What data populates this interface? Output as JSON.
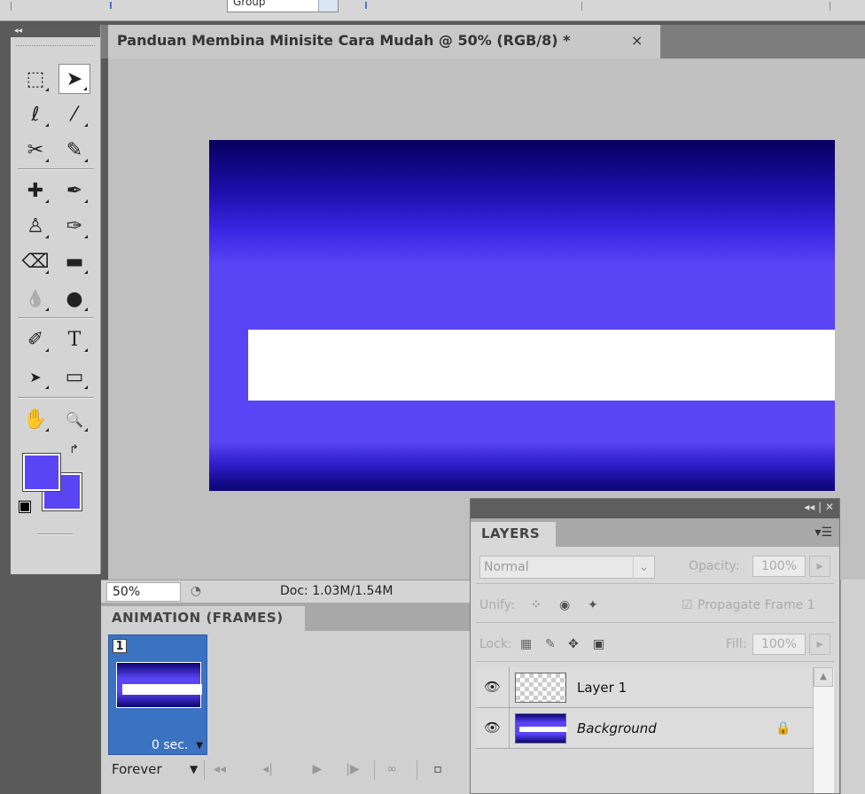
{
  "options_bar": {
    "group_field": "Group"
  },
  "document": {
    "tab_title": "Panduan Membina Minisite Cara Mudah @ 50% (RGB/8) *",
    "close_glyph": "×",
    "zoom": "50%",
    "doc_info": "Doc: 1.03M/1.54M",
    "colors": {
      "blue": "#5a45f6",
      "dark_blue": "#08005e",
      "white": "#ffffff"
    }
  },
  "toolbox": {
    "collapse": "◂◂",
    "tools": [
      {
        "name": "marquee-icon",
        "glyph": "⬚"
      },
      {
        "name": "move-icon",
        "glyph": "➤"
      },
      {
        "name": "lasso-icon",
        "glyph": "ℓ"
      },
      {
        "name": "magic-wand-icon",
        "glyph": "⁄"
      },
      {
        "name": "crop-icon",
        "glyph": "✂"
      },
      {
        "name": "eyedropper-icon",
        "glyph": "✎"
      },
      {
        "name": "healing-brush-icon",
        "glyph": "✚"
      },
      {
        "name": "brush-icon",
        "glyph": "✒"
      },
      {
        "name": "stamp-icon",
        "glyph": "♙"
      },
      {
        "name": "history-brush-icon",
        "glyph": "✑"
      },
      {
        "name": "eraser-icon",
        "glyph": "⌫"
      },
      {
        "name": "gradient-icon",
        "glyph": "▬"
      },
      {
        "name": "blur-icon",
        "glyph": "💧"
      },
      {
        "name": "dodge-icon",
        "glyph": "●"
      },
      {
        "name": "pen-icon",
        "glyph": "✐"
      },
      {
        "name": "type-icon",
        "glyph": "T"
      },
      {
        "name": "path-select-icon",
        "glyph": "➤"
      },
      {
        "name": "shape-icon",
        "glyph": "▭"
      },
      {
        "name": "hand-icon",
        "glyph": "✋"
      },
      {
        "name": "zoom-icon",
        "glyph": "🔍"
      }
    ],
    "foreground_color": "#5a45f5",
    "background_color": "#5a45f5"
  },
  "animation": {
    "title": "ANIMATION (FRAMES)",
    "frame_number": "1",
    "frame_delay": "0 sec.",
    "loop": "Forever",
    "controls": [
      "◂◂",
      "◂|",
      "▶",
      "|▶",
      "∞",
      "▫"
    ]
  },
  "layers": {
    "title": "LAYERS",
    "blend_mode": "Normal",
    "opacity_label": "Opacity:",
    "opacity_value": "100%",
    "unify_label": "Unify:",
    "propagate_label": "Propagate Frame 1",
    "lock_label": "Lock:",
    "fill_label": "Fill:",
    "fill_value": "100%",
    "items": [
      {
        "name": "Layer 1",
        "locked": false
      },
      {
        "name": "Background",
        "locked": true
      }
    ]
  }
}
